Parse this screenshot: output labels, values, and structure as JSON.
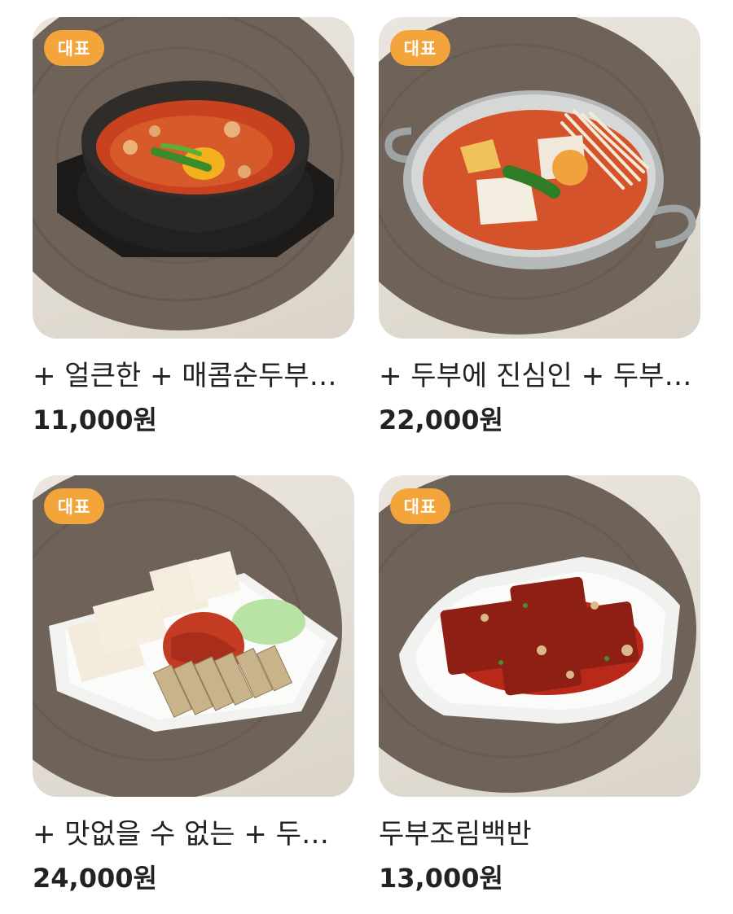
{
  "menu_items": [
    {
      "badge": "대표",
      "name": "+ 얼큰한 + 매콤순두부찌개",
      "price": "11,000원"
    },
    {
      "badge": "대표",
      "name": "+ 두부에 진심인 + 두부전골",
      "price": "22,000원"
    },
    {
      "badge": "대표",
      "name": "+ 맛없을 수 없는 + 두부보쌈",
      "price": "24,000원"
    },
    {
      "badge": "대표",
      "name": "두부조림백반",
      "price": "13,000원"
    }
  ],
  "colors": {
    "badge_bg": "#f3a43a",
    "text": "#222222",
    "placemat": "#6e6259"
  }
}
